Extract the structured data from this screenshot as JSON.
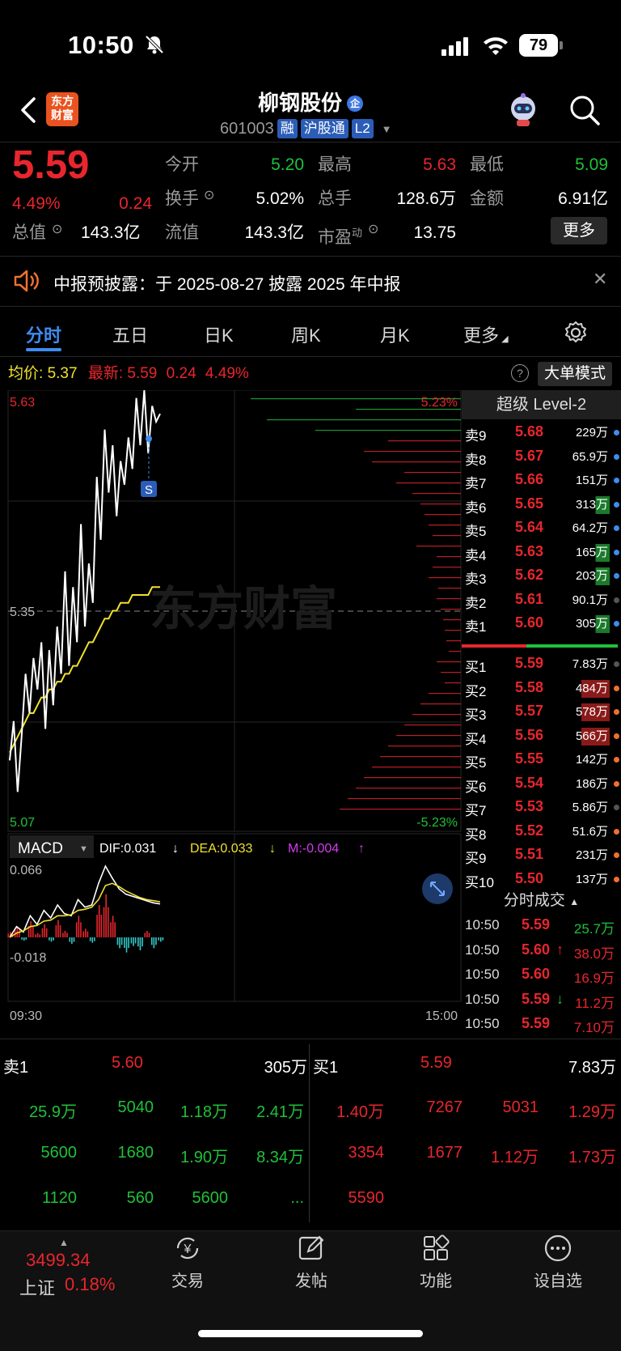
{
  "status_bar": {
    "time": "10:50",
    "battery": "79"
  },
  "header": {
    "logo": "东方\n财富",
    "title": "柳钢股份",
    "title_badge": "企",
    "code": "601003",
    "tags": [
      "融",
      "沪股通",
      "L2"
    ]
  },
  "quote": {
    "price": "5.59",
    "change_pct": "4.49%",
    "change": "0.24",
    "today_open_label": "今开",
    "today_open": "5.20",
    "high_label": "最高",
    "high": "5.63",
    "low_label": "最低",
    "low": "5.09",
    "turnover_label": "换手",
    "turnover": "5.02%",
    "volume_label": "总手",
    "volume": "128.6万",
    "amount_label": "金额",
    "amount": "6.91亿",
    "total_value_label": "总值",
    "total_value": "143.3亿",
    "float_value_label": "流值",
    "float_value": "143.3亿",
    "pe_label": "市盈",
    "pe_sup": "动",
    "pe": "13.75",
    "more_label": "更多"
  },
  "notice": {
    "text": "中报预披露：于 2025-08-27 披露 2025 年中报"
  },
  "tabs": [
    "分时",
    "五日",
    "日K",
    "周K",
    "月K",
    "更多"
  ],
  "chart_info": {
    "avg_label": "均价:",
    "avg": "5.37",
    "latest_label": "最新:",
    "latest": "5.59",
    "change": "0.24",
    "pct": "4.49%",
    "big_order_btn": "大单模式"
  },
  "chart_data": {
    "type": "line",
    "y_top_label": "5.63",
    "y_mid_label": "5.35",
    "y_bottom_label": "5.07",
    "pct_top": "5.23%",
    "pct_bottom": "-5.23%",
    "watermark": "东方财富",
    "signal": "S",
    "series": [
      {
        "name": "price",
        "color": "#ffffff",
        "values": [
          5.16,
          5.21,
          5.12,
          5.19,
          5.27,
          5.22,
          5.29,
          5.25,
          5.31,
          5.2,
          5.3,
          5.23,
          5.33,
          5.27,
          5.4,
          5.28,
          5.38,
          5.31,
          5.46,
          5.33,
          5.41,
          5.36,
          5.52,
          5.44,
          5.58,
          5.5,
          5.56,
          5.47,
          5.54,
          5.51,
          5.57,
          5.53,
          5.62,
          5.56,
          5.63,
          5.55,
          5.61,
          5.59,
          5.6
        ]
      },
      {
        "name": "avg",
        "color": "#f0e12e",
        "values": [
          5.17,
          5.18,
          5.19,
          5.2,
          5.21,
          5.22,
          5.22,
          5.23,
          5.24,
          5.24,
          5.25,
          5.25,
          5.26,
          5.26,
          5.27,
          5.27,
          5.28,
          5.28,
          5.29,
          5.3,
          5.31,
          5.31,
          5.32,
          5.33,
          5.34,
          5.34,
          5.35,
          5.35,
          5.36,
          5.36,
          5.36,
          5.37,
          5.37,
          5.37,
          5.37,
          5.37,
          5.38,
          5.38,
          5.38
        ]
      }
    ]
  },
  "macd": {
    "label": "MACD",
    "dif": "DIF:0.031",
    "dea": "DEA:0.033",
    "m": "M:-0.004",
    "top": "0.066",
    "bottom": "-0.018",
    "dif_values": [
      0.0,
      0.01,
      0.005,
      0.02,
      0.012,
      0.025,
      0.018,
      0.03,
      0.022,
      0.02,
      0.035,
      0.028,
      0.03,
      0.05,
      0.066,
      0.055,
      0.045,
      0.04,
      0.038,
      0.036,
      0.034,
      0.032,
      0.031
    ],
    "dea_values": [
      0.0,
      0.004,
      0.006,
      0.01,
      0.011,
      0.015,
      0.016,
      0.02,
      0.02,
      0.021,
      0.025,
      0.026,
      0.028,
      0.035,
      0.048,
      0.05,
      0.047,
      0.043,
      0.04,
      0.037,
      0.035,
      0.034,
      0.033
    ],
    "bars": [
      0.005,
      0.01,
      -0.003,
      0.015,
      0.004,
      0.012,
      -0.004,
      0.016,
      0.006,
      -0.006,
      0.02,
      0.008,
      -0.005,
      0.03,
      0.04,
      0.02,
      -0.01,
      -0.014,
      -0.008,
      -0.012,
      0.006,
      -0.01,
      -0.004
    ]
  },
  "time_axis": {
    "start": "09:30",
    "end": "15:00"
  },
  "level2": {
    "title": "超级 Level-2",
    "asks": [
      {
        "label": "卖9",
        "price": "5.68",
        "vol": "229万",
        "dot": "#3e8cf0"
      },
      {
        "label": "卖8",
        "price": "5.67",
        "vol": "65.9万",
        "dot": "#3e8cf0"
      },
      {
        "label": "卖7",
        "price": "5.66",
        "vol": "151万",
        "dot": "#3e8cf0"
      },
      {
        "label": "卖6",
        "price": "5.65",
        "vol": "313万",
        "dot": "#3e8cf0"
      },
      {
        "label": "卖5",
        "price": "5.64",
        "vol": "64.2万",
        "dot": "#3e8cf0"
      },
      {
        "label": "卖4",
        "price": "5.63",
        "vol": "165万",
        "dot": "#3e8cf0"
      },
      {
        "label": "卖3",
        "price": "5.62",
        "vol": "203万",
        "dot": "#3e8cf0"
      },
      {
        "label": "卖2",
        "price": "5.61",
        "vol": "90.1万",
        "dot": "#555"
      },
      {
        "label": "卖1",
        "price": "5.60",
        "vol": "305万",
        "dot": "#3e8cf0"
      }
    ],
    "bids": [
      {
        "label": "买1",
        "price": "5.59",
        "vol": "7.83万",
        "dot": "#555"
      },
      {
        "label": "买2",
        "price": "5.58",
        "vol": "484万",
        "dot": "#f07030"
      },
      {
        "label": "买3",
        "price": "5.57",
        "vol": "578万",
        "dot": "#f07030"
      },
      {
        "label": "买4",
        "price": "5.56",
        "vol": "566万",
        "dot": "#f07030"
      },
      {
        "label": "买5",
        "price": "5.55",
        "vol": "142万",
        "dot": "#f07030"
      },
      {
        "label": "买6",
        "price": "5.54",
        "vol": "186万",
        "dot": "#f07030"
      },
      {
        "label": "买7",
        "price": "5.53",
        "vol": "5.86万",
        "dot": "#555"
      },
      {
        "label": "买8",
        "price": "5.52",
        "vol": "51.6万",
        "dot": "#f07030"
      },
      {
        "label": "买9",
        "price": "5.51",
        "vol": "231万",
        "dot": "#f07030"
      },
      {
        "label": "买10",
        "price": "5.50",
        "vol": "137万",
        "dot": "#f07030"
      }
    ]
  },
  "trades": {
    "title": "分时成交",
    "rows": [
      {
        "time": "10:50",
        "price": "5.59",
        "vol": "25.7万",
        "arrow": "",
        "vcolor": "green"
      },
      {
        "time": "10:50",
        "price": "5.60",
        "vol": "38.0万",
        "arrow": "↑",
        "vcolor": "red"
      },
      {
        "time": "10:50",
        "price": "5.60",
        "vol": "16.9万",
        "arrow": "",
        "vcolor": "red"
      },
      {
        "time": "10:50",
        "price": "5.59",
        "vol": "11.2万",
        "arrow": "↓",
        "vcolor": "red"
      },
      {
        "time": "10:50",
        "price": "5.59",
        "vol": "7.10万",
        "arrow": "",
        "vcolor": "red"
      }
    ]
  },
  "queue": {
    "sell_label": "卖1",
    "sell_price": "5.60",
    "sell_total": "305万",
    "buy_label": "买1",
    "buy_price": "5.59",
    "buy_total": "7.83万",
    "sell_items": [
      "25.9万",
      "5040",
      "1.18万",
      "2.41万",
      "5600",
      "1680",
      "1.90万",
      "8.34万",
      "1120",
      "560",
      "5600",
      "..."
    ],
    "buy_items": [
      "1.40万",
      "7267",
      "5031",
      "1.29万",
      "3354",
      "1677",
      "1.12万",
      "1.73万",
      "5590"
    ]
  },
  "bottom_nav": {
    "index_value": "3499.34",
    "index_name": "上证",
    "index_pct": "0.18%",
    "items": [
      "交易",
      "发帖",
      "功能",
      "设自选"
    ]
  }
}
